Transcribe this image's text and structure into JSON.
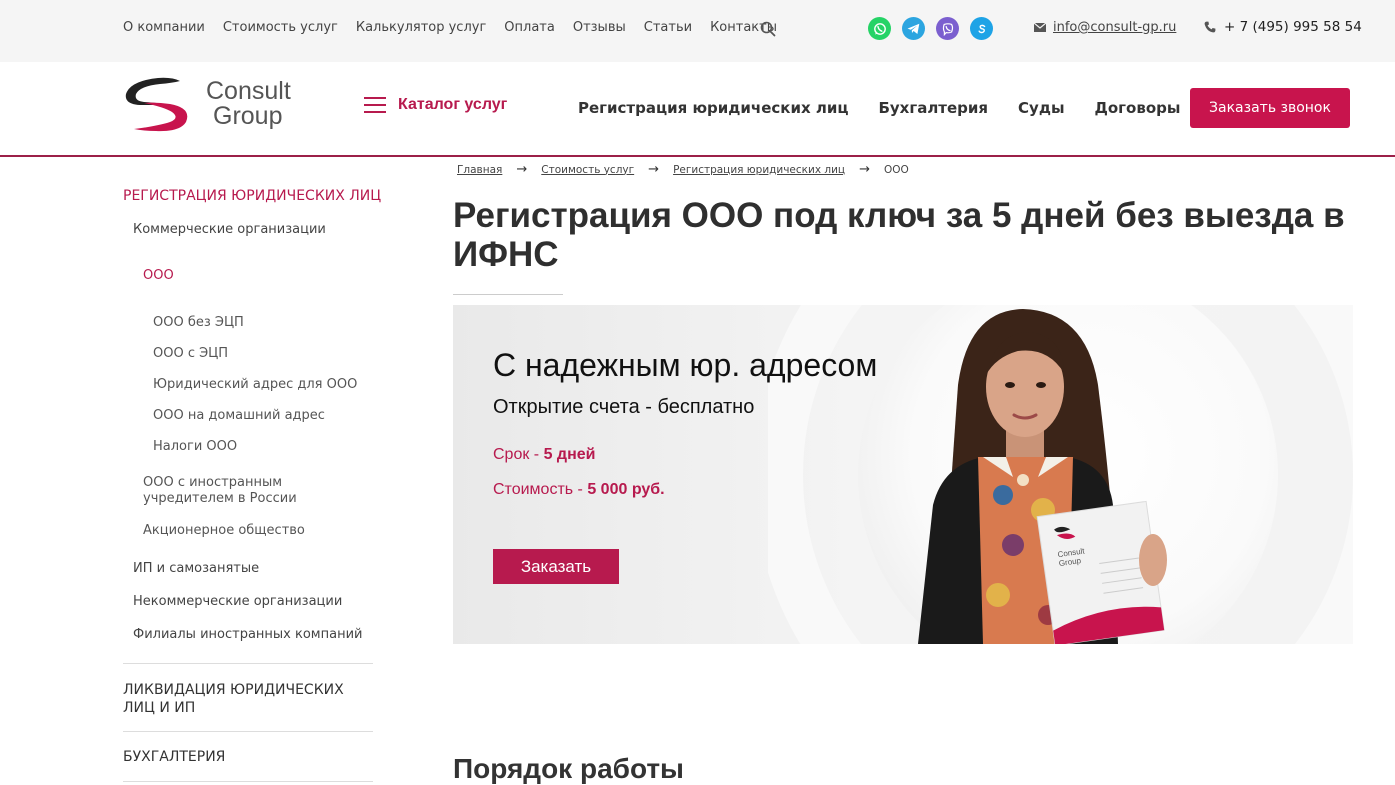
{
  "topbar": {
    "nav": [
      "О компании",
      "Стоимость услуг",
      "Калькулятор услуг",
      "Оплата",
      "Отзывы",
      "Статьи",
      "Контакты"
    ],
    "search_icon": "search-icon",
    "messengers": [
      {
        "name": "whatsapp-icon",
        "color": "#25d366"
      },
      {
        "name": "telegram-icon",
        "color": "#2ca5e0"
      },
      {
        "name": "viber-icon",
        "color": "#7b5fcf"
      },
      {
        "name": "skype-icon",
        "color": "#1ea3e6"
      }
    ],
    "email": "info@consult-gp.ru",
    "phone": "+ 7 (495) 995 58 54"
  },
  "header": {
    "logo_line1": "Consult",
    "logo_line2": "Group",
    "catalog_label": "Каталог услуг",
    "nav": [
      "Регистрация юридических лиц",
      "Бухгалтерия",
      "Суды",
      "Договоры"
    ],
    "call_button": "Заказать звонок"
  },
  "sidebar": {
    "section1": "РЕГИСТРАЦИЯ ЮРИДИЧЕСКИХ ЛИЦ",
    "commercial": "Коммерческие организации",
    "ooo": "ООО",
    "ooo_children": [
      "ООО без ЭЦП",
      "ООО с ЭЦП",
      "Юридический адрес для ООО",
      "ООО на домашний адрес",
      "Налоги ООО"
    ],
    "foreign_founder": "ООО с иностранным учредителем в России",
    "jsc": "Акционерное общество",
    "ip": "ИП и самозанятые",
    "nonprofit": "Некоммерческие организации",
    "branches": "Филиалы иностранных компаний",
    "section2": "ЛИКВИДАЦИЯ ЮРИДИЧЕСКИХ ЛИЦ И ИП",
    "section3": "БУХГАЛТЕРИЯ"
  },
  "breadcrumb": {
    "items": [
      "Главная",
      "Стоимость услуг",
      "Регистрация юридических лиц"
    ],
    "current": "ООО"
  },
  "page": {
    "title": "Регистрация ООО под ключ за 5 дней без выезда в ИФНС",
    "section_title": "Порядок работы"
  },
  "banner": {
    "heading": "С надежным юр. адресом",
    "subheading": "Открытие счета - бесплатно",
    "term_label": "Срок - ",
    "term_value": "5 дней",
    "price_label": "Стоимость - ",
    "price_value": "5 000 руб.",
    "button": "Заказать",
    "booklet_text1": "Consult",
    "booklet_text2": "Group"
  },
  "colors": {
    "accent": "#b71a4e",
    "button": "#c8144d"
  }
}
